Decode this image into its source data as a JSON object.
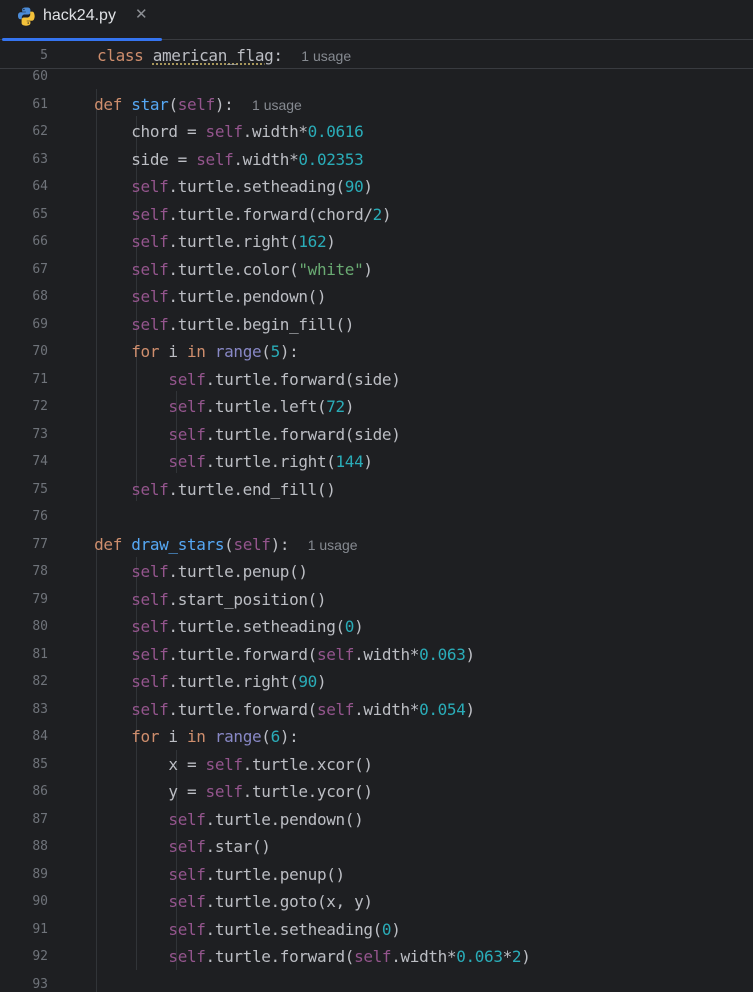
{
  "tab": {
    "filename": "hack24.py",
    "close_glyph": "✕",
    "icon": "python-file-icon"
  },
  "sticky": {
    "line_number": "5",
    "keyword": "class",
    "class_name": "american_flag",
    "colon": ":",
    "usage_hint": "1 usage"
  },
  "lines": [
    {
      "n": "60",
      "code": ""
    },
    {
      "n": "61",
      "code": "    def star(self):",
      "hint": "1 usage"
    },
    {
      "n": "62",
      "code": "        chord = self.width*0.0616"
    },
    {
      "n": "63",
      "code": "        side = self.width*0.02353"
    },
    {
      "n": "64",
      "code": "        self.turtle.setheading(90)"
    },
    {
      "n": "65",
      "code": "        self.turtle.forward(chord/2)"
    },
    {
      "n": "66",
      "code": "        self.turtle.right(162)"
    },
    {
      "n": "67",
      "code": "        self.turtle.color(\"white\")"
    },
    {
      "n": "68",
      "code": "        self.turtle.pendown()"
    },
    {
      "n": "69",
      "code": "        self.turtle.begin_fill()"
    },
    {
      "n": "70",
      "code": "        for i in range(5):"
    },
    {
      "n": "71",
      "code": "            self.turtle.forward(side)"
    },
    {
      "n": "72",
      "code": "            self.turtle.left(72)"
    },
    {
      "n": "73",
      "code": "            self.turtle.forward(side)"
    },
    {
      "n": "74",
      "code": "            self.turtle.right(144)"
    },
    {
      "n": "75",
      "code": "        self.turtle.end_fill()"
    },
    {
      "n": "76",
      "code": ""
    },
    {
      "n": "77",
      "code": "    def draw_stars(self):",
      "hint": "1 usage"
    },
    {
      "n": "78",
      "code": "        self.turtle.penup()"
    },
    {
      "n": "79",
      "code": "        self.start_position()"
    },
    {
      "n": "80",
      "code": "        self.turtle.setheading(0)"
    },
    {
      "n": "81",
      "code": "        self.turtle.forward(self.width*0.063)"
    },
    {
      "n": "82",
      "code": "        self.turtle.right(90)"
    },
    {
      "n": "83",
      "code": "        self.turtle.forward(self.width*0.054)"
    },
    {
      "n": "84",
      "code": "        for i in range(6):"
    },
    {
      "n": "85",
      "code": "            x = self.turtle.xcor()"
    },
    {
      "n": "86",
      "code": "            y = self.turtle.ycor()"
    },
    {
      "n": "87",
      "code": "            self.turtle.pendown()"
    },
    {
      "n": "88",
      "code": "            self.star()"
    },
    {
      "n": "89",
      "code": "            self.turtle.penup()"
    },
    {
      "n": "90",
      "code": "            self.turtle.goto(x, y)"
    },
    {
      "n": "91",
      "code": "            self.turtle.setheading(0)"
    },
    {
      "n": "92",
      "code": "            self.turtle.forward(self.width*0.063*2)"
    },
    {
      "n": "93",
      "code": ""
    }
  ],
  "colors": {
    "background": "#1e1f22",
    "keyword": "#cf8e6d",
    "function": "#56a8f5",
    "self": "#94558d",
    "number": "#2aacb8",
    "string": "#6aab73",
    "builtin": "#8888c6",
    "text": "#bcbec4",
    "line_number": "#6f737a",
    "tab_accent": "#3574f0"
  }
}
